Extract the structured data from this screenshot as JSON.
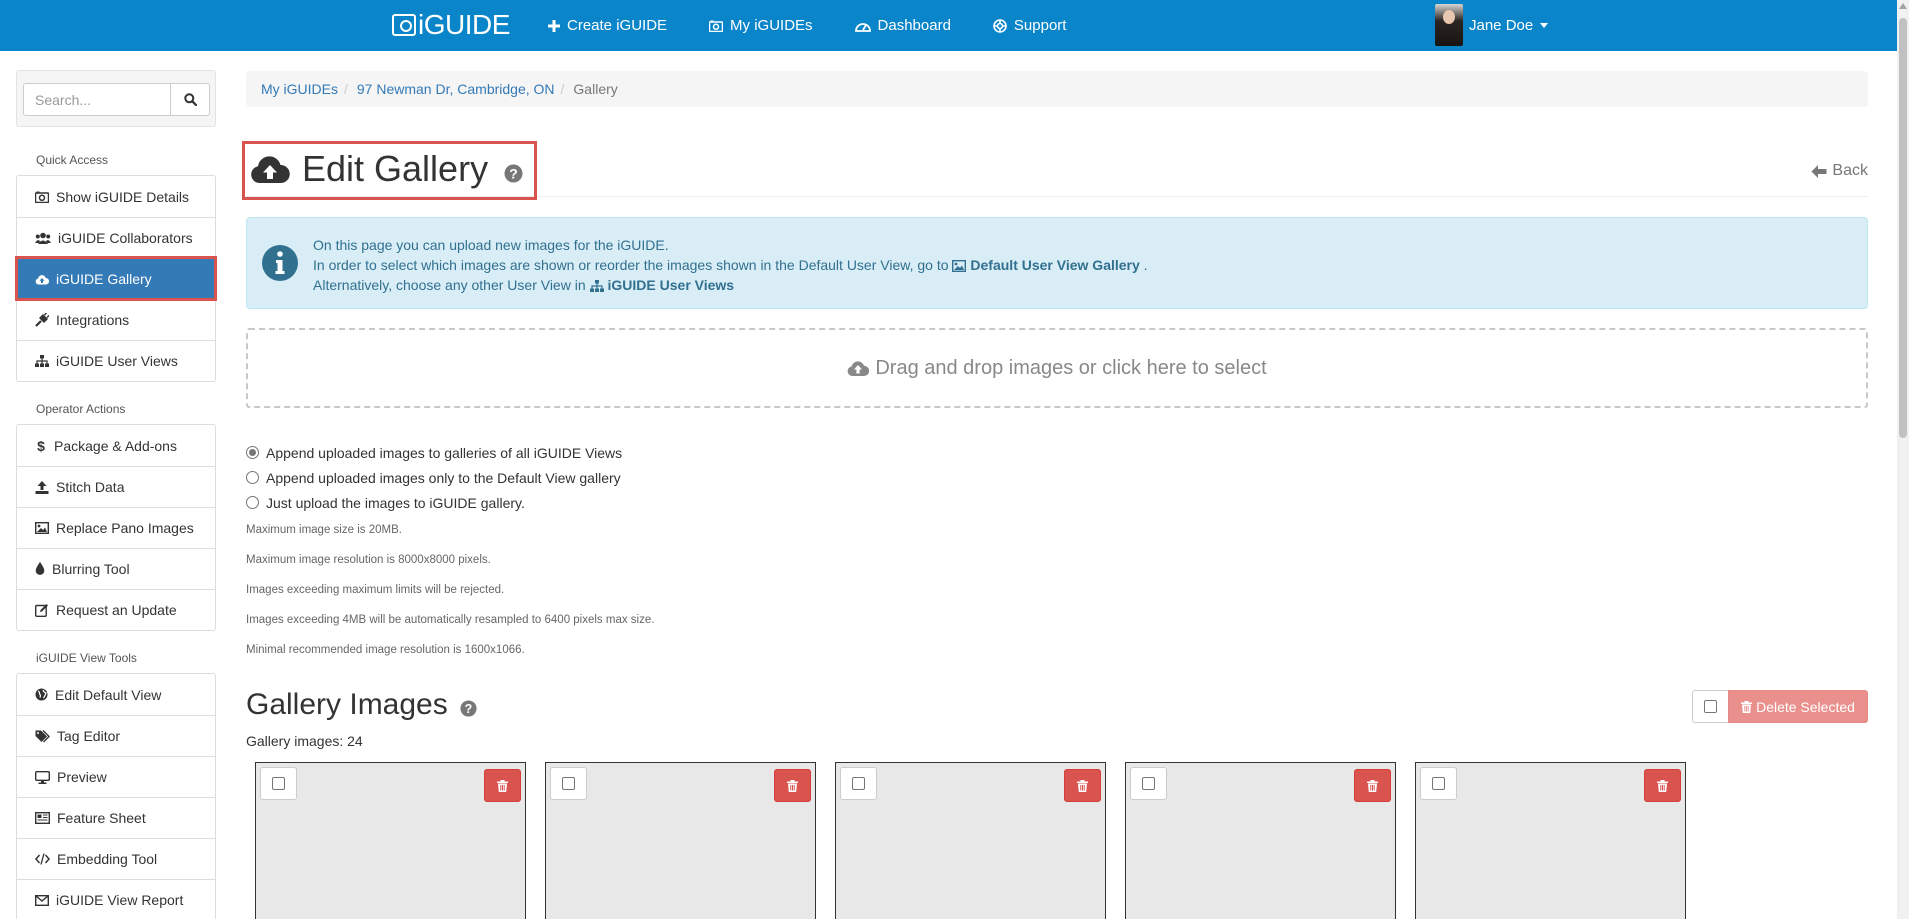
{
  "nav": {
    "brand": "iGUIDE",
    "links": [
      {
        "label": "Create iGUIDE",
        "icon": "plus-icon"
      },
      {
        "label": "My iGUIDEs",
        "icon": "camera-icon"
      },
      {
        "label": "Dashboard",
        "icon": "dashboard-icon"
      },
      {
        "label": "Support",
        "icon": "lifebuoy-icon"
      }
    ],
    "user": "Jane Doe"
  },
  "sidebar": {
    "search_placeholder": "Search...",
    "sections": [
      {
        "title": "Quick Access",
        "items": [
          {
            "label": "Show iGUIDE Details",
            "icon": "camera-icon"
          },
          {
            "label": "iGUIDE Collaborators",
            "icon": "users-icon"
          },
          {
            "label": "iGUIDE Gallery",
            "icon": "cloud-upload-icon",
            "active": true
          },
          {
            "label": "Integrations",
            "icon": "plug-icon"
          },
          {
            "label": "iGUIDE User Views",
            "icon": "sitemap-icon"
          }
        ]
      },
      {
        "title": "Operator Actions",
        "items": [
          {
            "label": "Package & Add-ons",
            "icon": "dollar-icon"
          },
          {
            "label": "Stitch Data",
            "icon": "upload-icon"
          },
          {
            "label": "Replace Pano Images",
            "icon": "image-icon"
          },
          {
            "label": "Blurring Tool",
            "icon": "droplet-icon"
          },
          {
            "label": "Request an Update",
            "icon": "edit-icon"
          }
        ]
      },
      {
        "title": "iGUIDE View Tools",
        "items": [
          {
            "label": "Edit Default View",
            "icon": "globe-icon"
          },
          {
            "label": "Tag Editor",
            "icon": "tags-icon"
          },
          {
            "label": "Preview",
            "icon": "desktop-icon"
          },
          {
            "label": "Feature Sheet",
            "icon": "newspaper-icon"
          },
          {
            "label": "Embedding Tool",
            "icon": "code-icon"
          },
          {
            "label": "iGUIDE View Report",
            "icon": "envelope-icon"
          }
        ]
      }
    ]
  },
  "breadcrumb": {
    "items": [
      "My iGUIDEs",
      "97 Newman Dr, Cambridge, ON"
    ],
    "active": "Gallery"
  },
  "header": {
    "title": "Edit Gallery",
    "back_label": "Back"
  },
  "info": {
    "line1": "On this page you can upload new images for the iGUIDE.",
    "line2_prefix": "In order to select which images are shown or reorder the images shown in the Default User View, go to",
    "line2_link": "Default User View Gallery",
    "line2_suffix": ".",
    "line3_prefix": "Alternatively, choose any other User View in",
    "line3_link": "iGUIDE User Views"
  },
  "dropzone": {
    "label": "Drag and drop images or click here to select"
  },
  "upload_options": [
    {
      "label": "Append uploaded images to galleries of all iGUIDE Views",
      "checked": true
    },
    {
      "label": "Append uploaded images only to the Default View gallery",
      "checked": false
    },
    {
      "label": "Just upload the images to iGUIDE gallery.",
      "checked": false
    }
  ],
  "notes": [
    "Maximum image size is 20MB.",
    "Maximum image resolution is 8000x8000 pixels.",
    "Images exceeding maximum limits will be rejected.",
    "Images exceeding 4MB will be automatically resampled to 6400 pixels max size.",
    "Minimal recommended image resolution is 1600x1066."
  ],
  "gallery": {
    "title": "Gallery Images",
    "count_text": "Gallery images: 24",
    "delete_selected": "Delete Selected",
    "visible_cards": 5
  },
  "colors": {
    "navbar": "#0a85c9",
    "active": "#337ab7",
    "danger": "#d9534f",
    "highlight": "#d9534f",
    "info_bg": "#d9edf7"
  }
}
